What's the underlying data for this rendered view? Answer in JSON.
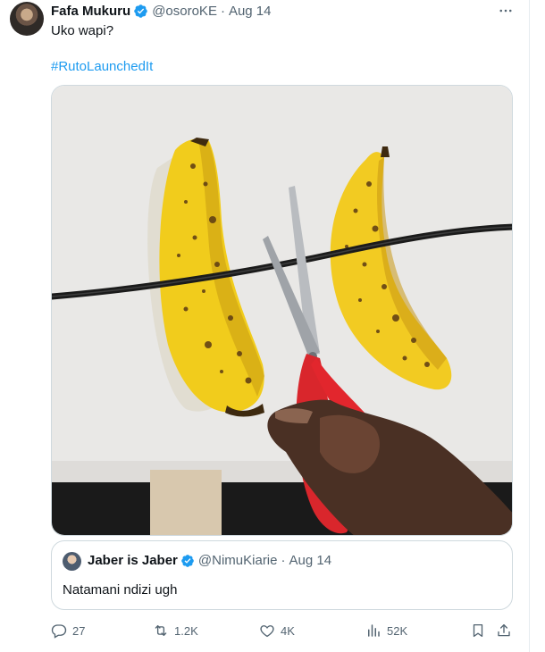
{
  "tweet": {
    "author_name": "Fafa Mukuru",
    "author_handle": "@osoroKE",
    "separator": "·",
    "time": "Aug 14",
    "text": "Uko wapi?",
    "hashtag": "#RutoLaunchedIt"
  },
  "quote": {
    "author_name": "Jaber is Jaber",
    "author_handle": "@NimuKiarie",
    "separator": "·",
    "time": "Aug 14",
    "text": "Natamani ndizi ugh"
  },
  "actions": {
    "replies": "27",
    "retweets": "1.2K",
    "likes": "4K",
    "views": "52K"
  },
  "icons": {
    "reply": "reply-icon",
    "retweet": "retweet-icon",
    "like": "heart-icon",
    "views": "views-icon",
    "bookmark": "bookmark-icon",
    "share": "share-icon",
    "more": "more-icon",
    "verified": "verified-badge-icon"
  },
  "colors": {
    "link": "#1d9bf0",
    "secondary_text": "#536471",
    "verified": "#1d9bf0",
    "border": "#cfd9de"
  }
}
